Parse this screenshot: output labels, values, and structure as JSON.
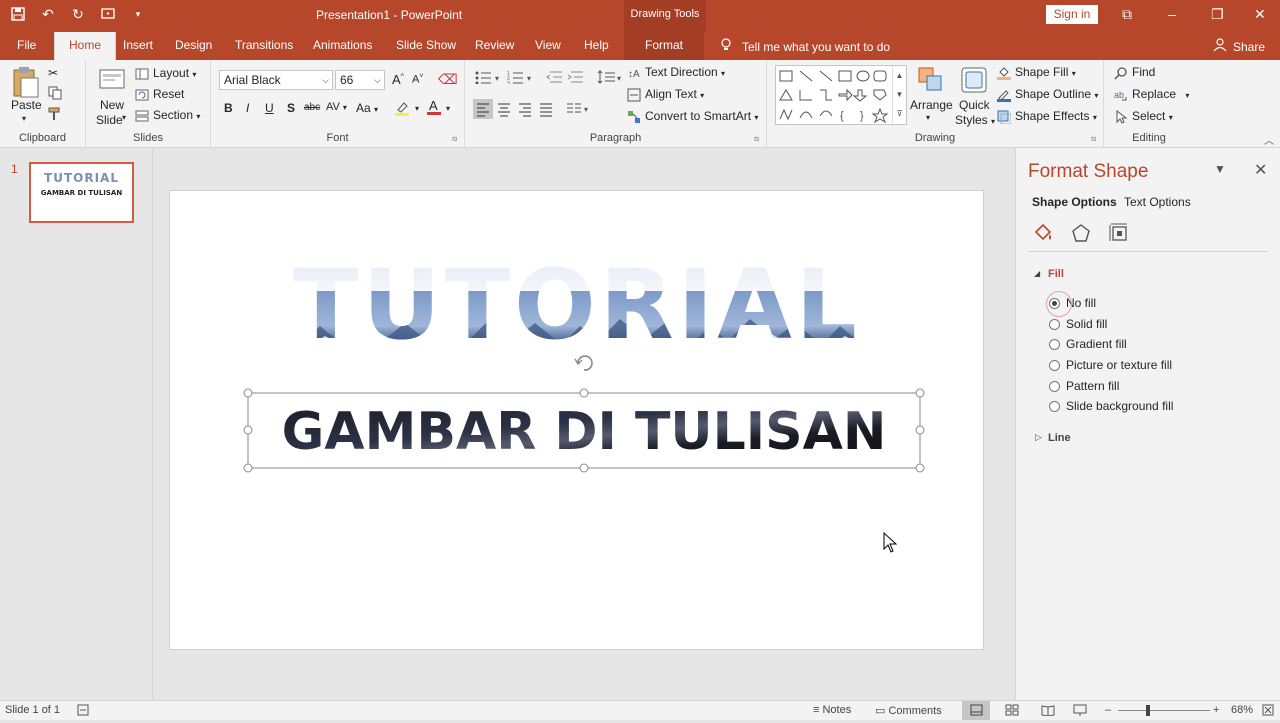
{
  "window": {
    "title": "Presentation1 - PowerPoint",
    "context_tab_title": "Drawing Tools",
    "sign_in": "Sign in",
    "minimize": "–",
    "restore": "❐",
    "close": "✕",
    "ribbon_options": "⧉"
  },
  "tabs": [
    "File",
    "Home",
    "Insert",
    "Design",
    "Transitions",
    "Animations",
    "Slide Show",
    "Review",
    "View",
    "Help",
    "Format"
  ],
  "tell_me": "Tell me what you want to do",
  "share": "Share",
  "ribbon": {
    "clipboard": {
      "paste": "Paste",
      "label": "Clipboard"
    },
    "slides": {
      "new_slide": "New",
      "new_slide2": "Slide",
      "layout": "Layout",
      "reset": "Reset",
      "section": "Section",
      "label": "Slides"
    },
    "font": {
      "name": "Arial Black",
      "size": "66",
      "label": "Font",
      "bold": "B",
      "italic": "I",
      "underline": "U",
      "shadow": "S",
      "strike": "abc",
      "spacing": "AV",
      "case": "Aa"
    },
    "paragraph": {
      "text_direction": "Text Direction",
      "align_text": "Align Text",
      "convert": "Convert to SmartArt",
      "label": "Paragraph"
    },
    "drawing": {
      "arrange": "Arrange",
      "quick_styles": "Quick",
      "quick_styles2": "Styles",
      "shape_fill": "Shape Fill",
      "shape_outline": "Shape Outline",
      "shape_effects": "Shape Effects",
      "label": "Drawing"
    },
    "editing": {
      "find": "Find",
      "replace": "Replace",
      "select": "Select",
      "label": "Editing"
    }
  },
  "thumbnail": {
    "number": "1",
    "line1": "TUTORIAL",
    "line2": "GAMBAR DI TULISAN"
  },
  "slide": {
    "title": "TUTORIAL",
    "subtitle": "GAMBAR DI TULISAN"
  },
  "format_pane": {
    "title": "Format Shape",
    "tab_shape": "Shape Options",
    "tab_text": "Text Options",
    "section_fill": "Fill",
    "fill_options": [
      "No fill",
      "Solid fill",
      "Gradient fill",
      "Picture or texture fill",
      "Pattern fill",
      "Slide background fill"
    ],
    "selected_fill": "No fill",
    "section_line": "Line"
  },
  "status": {
    "slide": "Slide 1 of 1",
    "notes": "Notes",
    "comments": "Comments",
    "zoom": "68%"
  },
  "colors": {
    "accent": "#b7472a"
  }
}
